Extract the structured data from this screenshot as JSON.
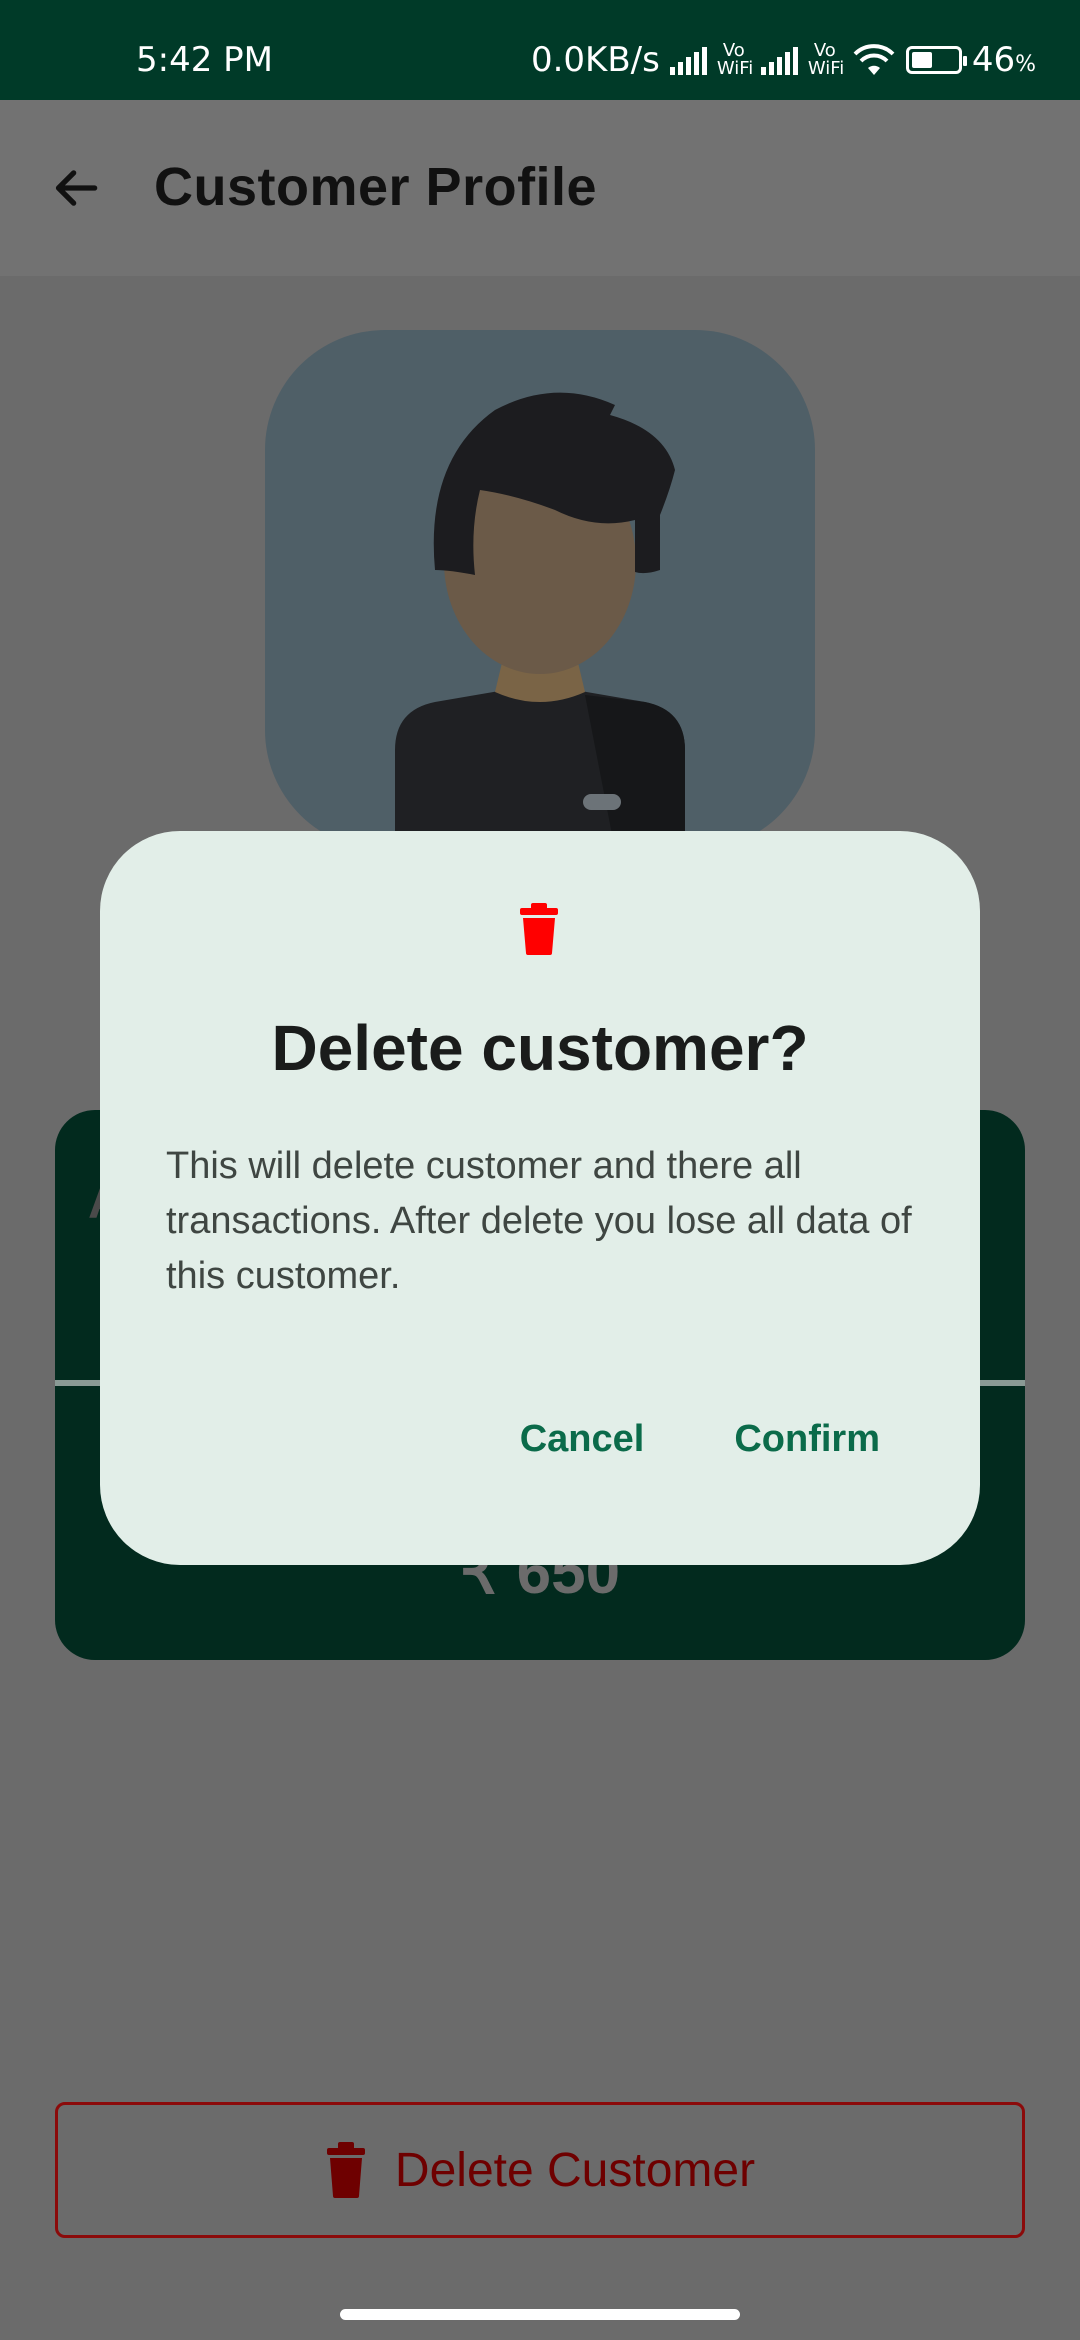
{
  "status_bar": {
    "time": "5:42 PM",
    "network_speed": "0.0KB/s",
    "vowifi_1": "Vo WiFi",
    "vowifi_2": "Vo WiFi",
    "battery": "46",
    "battery_unit": "%",
    "battery_level": 0.46
  },
  "header": {
    "title": "Customer Profile",
    "back_icon": "arrow-left-icon"
  },
  "background_card": {
    "amount": "₹ 650"
  },
  "footer": {
    "delete_label": "Delete Customer",
    "delete_icon": "trash-icon",
    "color": "#8b0a0a"
  },
  "dialog": {
    "icon": "trash-icon",
    "icon_color": "#ff0000",
    "title": "Delete customer?",
    "message": "This will delete customer and there all transactions. After delete you lose all data of this customer.",
    "cancel_label": "Cancel",
    "confirm_label": "Confirm",
    "accent": "#0b6b4a"
  }
}
